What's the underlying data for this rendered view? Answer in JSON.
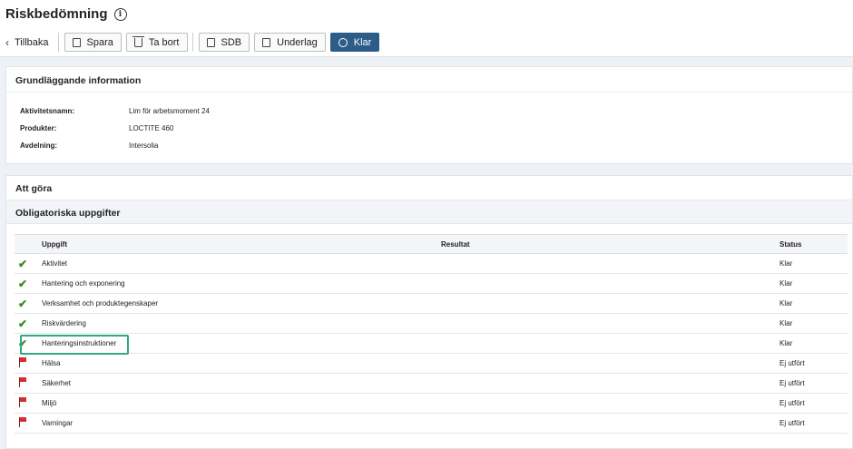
{
  "header": {
    "title": "Riskbedömning",
    "info_icon": "info-icon"
  },
  "toolbar": {
    "back_label": "Tillbaka",
    "save_label": "Spara",
    "delete_label": "Ta bort",
    "sdb_label": "SDB",
    "underlag_label": "Underlag",
    "done_label": "Klar",
    "done_color": "#2d5c87"
  },
  "basic_info": {
    "title": "Grundläggande information",
    "rows": [
      {
        "key": "Aktivitetsnamn:",
        "value": "Lim för arbetsmoment 24"
      },
      {
        "key": "Produkter:",
        "value": "LOCTITE 460"
      },
      {
        "key": "Avdelning:",
        "value": "Intersolia"
      }
    ]
  },
  "todo": {
    "title": "Att göra",
    "section_title": "Obligatoriska uppgifter",
    "columns": {
      "task": "Uppgift",
      "result": "Resultat",
      "status": "Status"
    },
    "rows": [
      {
        "icon": "check",
        "task": "Aktivitet",
        "result": "",
        "status": "Klar"
      },
      {
        "icon": "check",
        "task": "Hantering och exponering",
        "result": "",
        "status": "Klar"
      },
      {
        "icon": "check",
        "task": "Verksamhet och produktegenskaper",
        "result": "",
        "status": "Klar"
      },
      {
        "icon": "check",
        "task": "Riskvärdering",
        "result": "",
        "status": "Klar"
      },
      {
        "icon": "check",
        "task": "Hanteringsinstruktioner",
        "result": "",
        "status": "Klar"
      },
      {
        "icon": "flag",
        "task": "Hälsa",
        "result": "",
        "status": "Ej utfört"
      },
      {
        "icon": "flag",
        "task": "Säkerhet",
        "result": "",
        "status": "Ej utfört"
      },
      {
        "icon": "flag",
        "task": "Miljö",
        "result": "",
        "status": "Ej utfört"
      },
      {
        "icon": "flag",
        "task": "Varningar",
        "result": "",
        "status": "Ej utfört"
      }
    ],
    "check_color": "#3a8a1e",
    "flag_color": "#d62d2d",
    "highlight_color": "#2ea888"
  }
}
